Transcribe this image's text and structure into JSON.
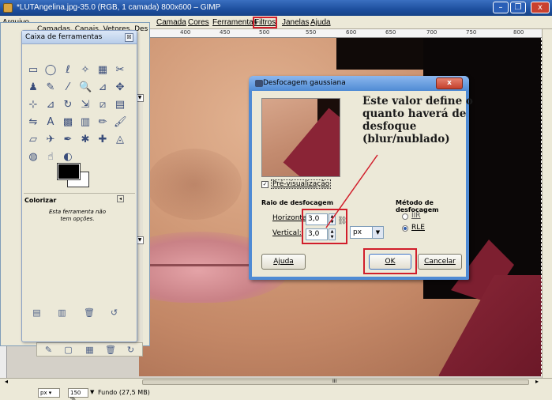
{
  "window": {
    "title": "*LUTAngelina.jpg-35.0 (RGB, 1 camada) 800x600 – GIMP",
    "min_glyph": "–",
    "max_glyph": "❐",
    "close_glyph": "x"
  },
  "menubar": {
    "items": [
      "Arquivo",
      "Camada",
      "Cores",
      "Ferramentas",
      "Filtros",
      "Janelas",
      "Ajuda"
    ],
    "highlighted": "Filtros"
  },
  "ruler": {
    "ticks": [
      "400",
      "450",
      "500",
      "550",
      "600",
      "650",
      "700",
      "750",
      "800"
    ]
  },
  "layers_panel": {
    "title": "Camadas, Canais, Vetores, Desfa..."
  },
  "toolbox": {
    "title": "Caixa de ferramentas",
    "close_glyph": "☒",
    "tools": [
      "rect-select-icon",
      "ellipse-select-icon",
      "free-select-icon",
      "fuzzy-select-icon",
      "color-select-icon",
      "scissors-icon",
      "foreground-select-icon",
      "paths-icon",
      "color-picker-icon",
      "zoom-icon",
      "measure-icon",
      "move-icon",
      "align-icon",
      "crop-icon",
      "rotate-icon",
      "scale-icon",
      "shear-icon",
      "perspective-icon",
      "flip-icon",
      "text-icon",
      "bucket-fill-icon",
      "blend-icon",
      "pencil-icon",
      "paintbrush-icon",
      "eraser-icon",
      "airbrush-icon",
      "ink-icon",
      "clone-icon",
      "heal-icon",
      "perspective-clone-icon",
      "blur-icon",
      "smudge-icon",
      "dodge-icon"
    ],
    "tool_glyphs": [
      "▭",
      "◯",
      "ℓ",
      "✧",
      "▦",
      "✂",
      "♟",
      "✎",
      "⁄",
      "🔍",
      "⊿",
      "✥",
      "⊹",
      "⊿",
      "↻",
      "⇲",
      "⧄",
      "▤",
      "⇋",
      "A",
      "▩",
      "▥",
      "✏",
      "🖌",
      "▱",
      "✈",
      "✒",
      "✱",
      "✚",
      "◬",
      "◍",
      "☝",
      "◐"
    ],
    "tool_options_title": "Colorizar",
    "tool_options_btn": "◂",
    "tool_options_text": "Esta ferramenta não tem opções.",
    "bottom_glyphs": [
      "▤",
      "▥",
      "🗑",
      "↺"
    ],
    "bg_bottom_glyphs": [
      "✎",
      "▢",
      "▦",
      "🗑",
      "↻"
    ]
  },
  "dialog": {
    "title": "Desfocagem gaussiana",
    "close_label": "x",
    "annotation": "Este valor define o quanto haverá de desfoque (blur/nublado)",
    "preview_checkbox_mark": "✓",
    "preview_label": "Pré-visualização",
    "blur_radius_title": "Raio de desfocagem",
    "horizontal_label": "Horizontal:",
    "horizontal_value": "3,0",
    "vertical_label": "Vertical:",
    "vertical_value": "3,0",
    "chain_glyph": "⛓",
    "spin_glyph_up": "▲",
    "spin_glyph_down": "▼",
    "unit": "px",
    "unit_arrow": "▼",
    "method_title": "Método de desfocagem",
    "method_options": [
      "IIR",
      "RLE"
    ],
    "method_selected": "RLE",
    "help_label": "Ajuda",
    "ok_label": "OK",
    "cancel_label": "Cancelar"
  },
  "statusbar": {
    "unit": "px ▾",
    "zoom": "150 %",
    "layer_info": "Fundo (27,5 MB)",
    "scroll_left": "◂",
    "scroll_right": "▸",
    "scroll_mid": "III"
  },
  "colors": {
    "accent_red": "#d11e2b",
    "title_blue": "#1d4f9e",
    "dialog_border": "#4f8bd4"
  }
}
